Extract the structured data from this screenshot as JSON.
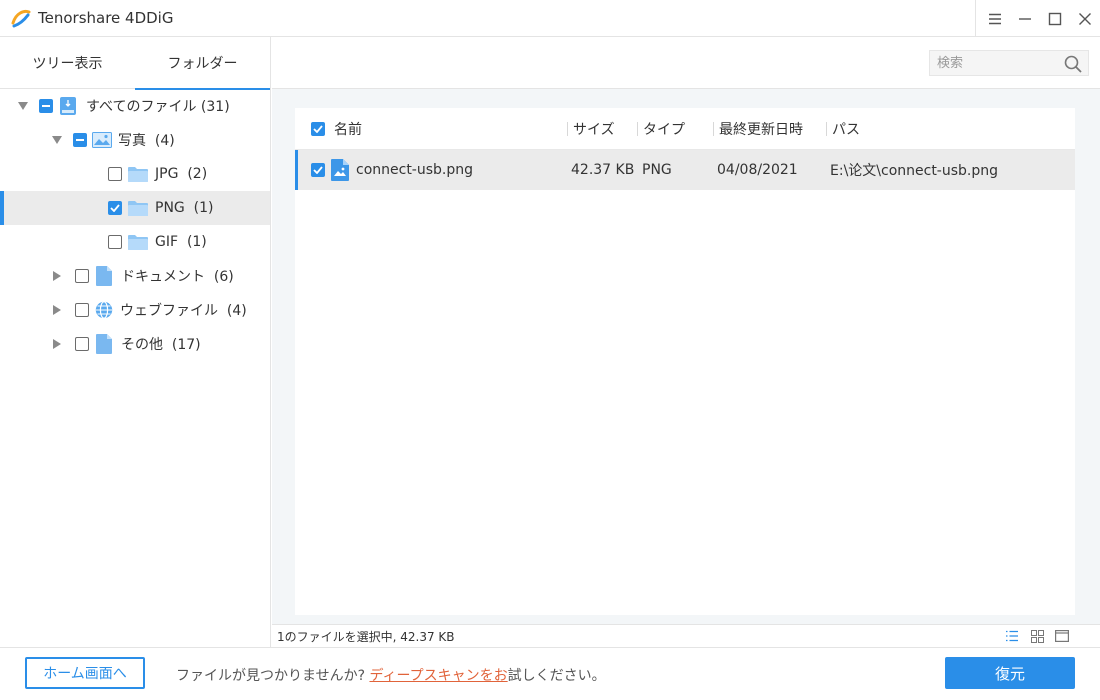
{
  "app": {
    "title": "Tenorshare 4DDiG"
  },
  "sidebar": {
    "tabs": [
      {
        "label": "ツリー表示",
        "active": false
      },
      {
        "label": "フォルダー",
        "active": true
      }
    ],
    "tree": [
      {
        "label": "すべてのファイル",
        "count": "(31)",
        "icon": "drive-icon",
        "check": "partial",
        "expanded": true
      },
      {
        "label": "写真",
        "count": "(4)",
        "icon": "image-icon",
        "check": "partial",
        "expanded": true
      },
      {
        "label": "JPG",
        "count": "(2)",
        "icon": "folder-icon",
        "check": "unchecked"
      },
      {
        "label": "PNG",
        "count": "(1)",
        "icon": "folder-icon",
        "check": "checked",
        "selected": true
      },
      {
        "label": "GIF",
        "count": "(1)",
        "icon": "folder-icon",
        "check": "unchecked"
      },
      {
        "label": "ドキュメント",
        "count": "(6)",
        "icon": "document-icon",
        "check": "unchecked",
        "expanded": false
      },
      {
        "label": "ウェブファイル",
        "count": "(4)",
        "icon": "globe-icon",
        "check": "unchecked",
        "expanded": false
      },
      {
        "label": "その他",
        "count": "(17)",
        "icon": "document-icon",
        "check": "unchecked",
        "expanded": false
      }
    ]
  },
  "search": {
    "placeholder": "検索",
    "value": ""
  },
  "file_list": {
    "columns": [
      "名前",
      "サイズ",
      "タイプ",
      "最終更新日時",
      "パス"
    ],
    "header_checked": true,
    "rows": [
      {
        "name": "connect-usb.png",
        "size": "42.37 KB",
        "type": "PNG",
        "modified": "04/08/2021",
        "path": "E:\\论文\\connect-usb.png",
        "checked": true,
        "icon": "image-file-icon"
      }
    ]
  },
  "status": {
    "text": "1のファイルを選択中, 42.37 KB"
  },
  "footer": {
    "home_label": "ホーム画面へ",
    "hint_before": "ファイルが見つかりませんか?",
    "hint_link": "ディープスキャンをお",
    "hint_after": "試しください。",
    "recover_label": "復元"
  },
  "colors": {
    "accent": "#2a8ee8",
    "link": "#e1633a",
    "selected_row": "#ebebeb"
  }
}
